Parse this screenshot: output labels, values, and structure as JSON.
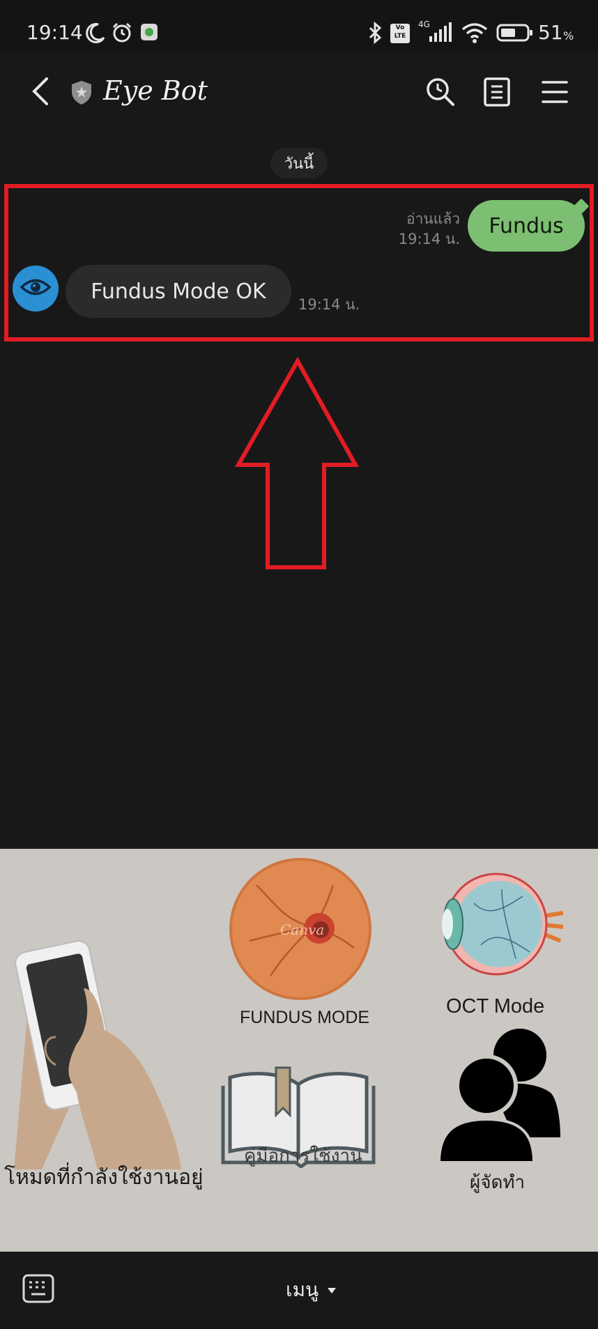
{
  "status_bar": {
    "time": "19:14",
    "battery": "51",
    "battery_unit": "%",
    "network": "4G",
    "volte": "Vo LTE",
    "icons": [
      "moon-icon",
      "alarm-icon",
      "app-notification-icon",
      "bluetooth-icon",
      "volte-icon",
      "signal-icon",
      "wifi-icon",
      "battery-icon"
    ]
  },
  "header": {
    "title": "Eye Bot",
    "icons": [
      "back-icon",
      "shield-badge-icon",
      "search-icon",
      "notes-icon",
      "menu-icon"
    ]
  },
  "chat": {
    "date_separator": "วันนี้",
    "messages": [
      {
        "direction": "outgoing",
        "text": "Fundus",
        "read_status": "อ่านแล้ว",
        "time": "19:14 น."
      },
      {
        "direction": "incoming",
        "text": "Fundus Mode OK",
        "time": "19:14 น."
      }
    ]
  },
  "rich_menu": {
    "items": [
      {
        "label": "โหมดที่กำลังใช้งานอยู่",
        "icon": "phone-hand-icon"
      },
      {
        "label": "FUNDUS MODE",
        "icon": "fundus-retina-icon",
        "watermark": "Canva"
      },
      {
        "label": "OCT Mode",
        "icon": "eyeball-icon"
      },
      {
        "label": "คู่มือการใช้งาน",
        "icon": "book-icon"
      },
      {
        "label": "ผู้จัดทำ",
        "icon": "people-icon"
      }
    ]
  },
  "bottom_bar": {
    "menu_label": "เมนู",
    "icons": [
      "keyboard-icon",
      "caret-down-icon"
    ]
  },
  "colors": {
    "background": "#181818",
    "outgoing_bubble": "#7dbf72",
    "incoming_bubble": "#2b2b2b",
    "avatar": "#2b8fd4",
    "highlight": "#e21c24",
    "rich_menu_bg": "#cbc8c3"
  }
}
